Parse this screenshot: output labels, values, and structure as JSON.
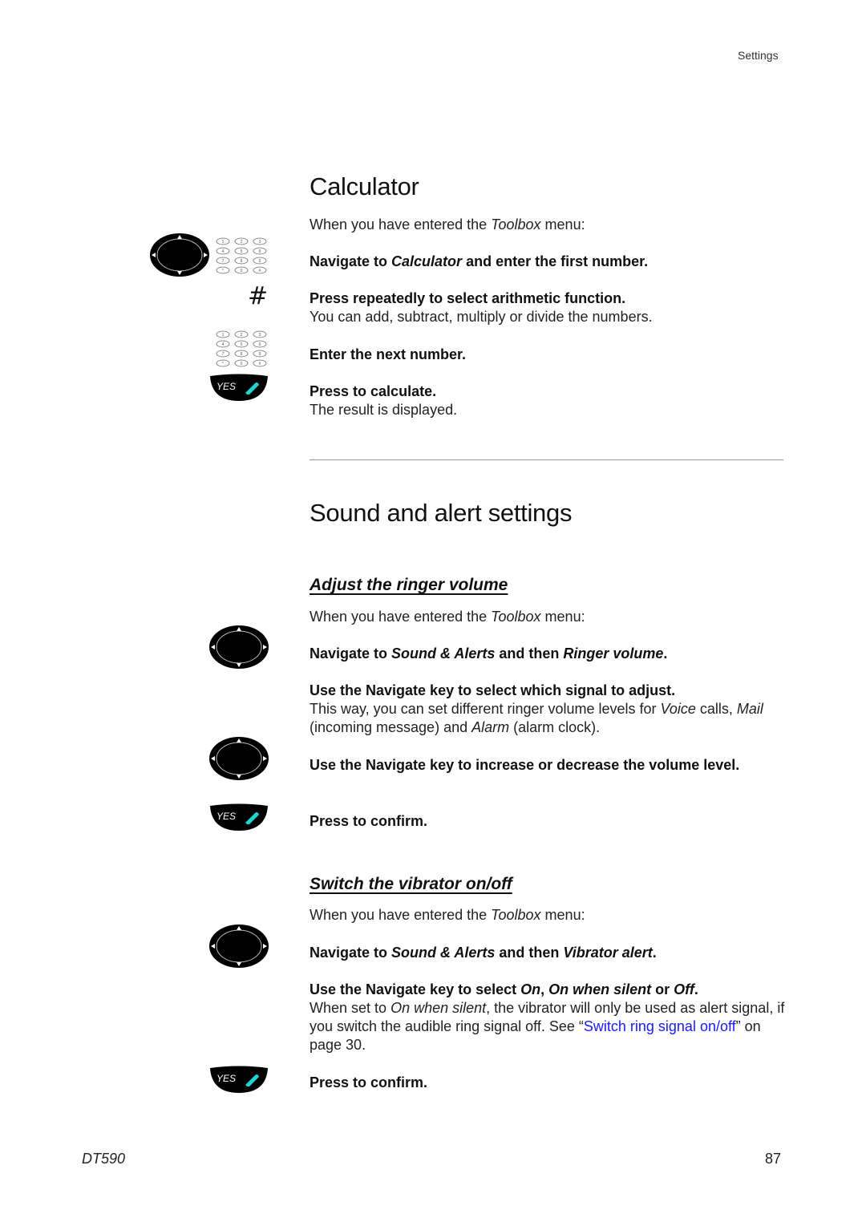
{
  "header": {
    "section": "Settings"
  },
  "calculator": {
    "title": "Calculator",
    "intro_prefix": "When you have entered the ",
    "intro_menu": "Toolbox",
    "intro_suffix": " menu:",
    "steps": [
      {
        "bold_prefix": "Navigate to ",
        "bold_italic": "Calculator",
        "bold_suffix": " and enter the first number.",
        "icon": "navigate-key-and-keypad"
      },
      {
        "bold": "Press repeatedly to select arithmetic function.",
        "text": "You can add, subtract, multiply or divide the numbers.",
        "icon": "hash-key",
        "icon_glyph": "#"
      },
      {
        "bold": "Enter the next number.",
        "icon": "keypad"
      },
      {
        "bold": "Press to calculate.",
        "text": "The result is displayed.",
        "icon": "yes-key"
      }
    ]
  },
  "sound": {
    "title": "Sound and alert settings",
    "ringer": {
      "subtitle": "Adjust the ringer volume",
      "intro_prefix": "When you have entered the ",
      "intro_menu": "Toolbox",
      "intro_suffix": " menu:",
      "step1": {
        "p1": "Navigate to ",
        "i1": "Sound & Alerts",
        "p2": " and then ",
        "i2": "Ringer volume",
        "p3": "."
      },
      "step2": {
        "bold": "Use the Navigate key to select which signal to adjust.",
        "t1": "This way, you can set different ringer volume levels for ",
        "i1": "Voice",
        "t2": " calls, ",
        "i2": "Mail",
        "t3": " (incoming message) and ",
        "i3": "Alarm",
        "t4": " (alarm clock)."
      },
      "step3": {
        "bold": "Use the Navigate key to increase or decrease the volume level."
      },
      "step4": {
        "bold": "Press to confirm."
      }
    },
    "vibrator": {
      "subtitle": "Switch the vibrator on/off",
      "intro_prefix": "When you have entered the ",
      "intro_menu": "Toolbox",
      "intro_suffix": " menu:",
      "step1": {
        "p1": "Navigate to ",
        "i1": "Sound & Alerts",
        "p2": " and then ",
        "i2": "Vibrator alert",
        "p3": "."
      },
      "step2": {
        "p1": "Use the Navigate key to select ",
        "i1": "On",
        "p2": ", ",
        "i2": "On when silent",
        "p3": " or ",
        "i3": "Off",
        "p4": ".",
        "t1": "When set to ",
        "ti1": "On when silent",
        "t2": ", the vibrator will only be used as alert signal, if you switch the audible ring signal off. See “",
        "link": "Switch ring signal on/off",
        "t3": "” on page 30."
      },
      "step3": {
        "bold": "Press to confirm."
      }
    }
  },
  "yes_key": {
    "label": "YES",
    "accent": "#1fd3d3"
  },
  "footer": {
    "model": "DT590",
    "page": "87"
  }
}
